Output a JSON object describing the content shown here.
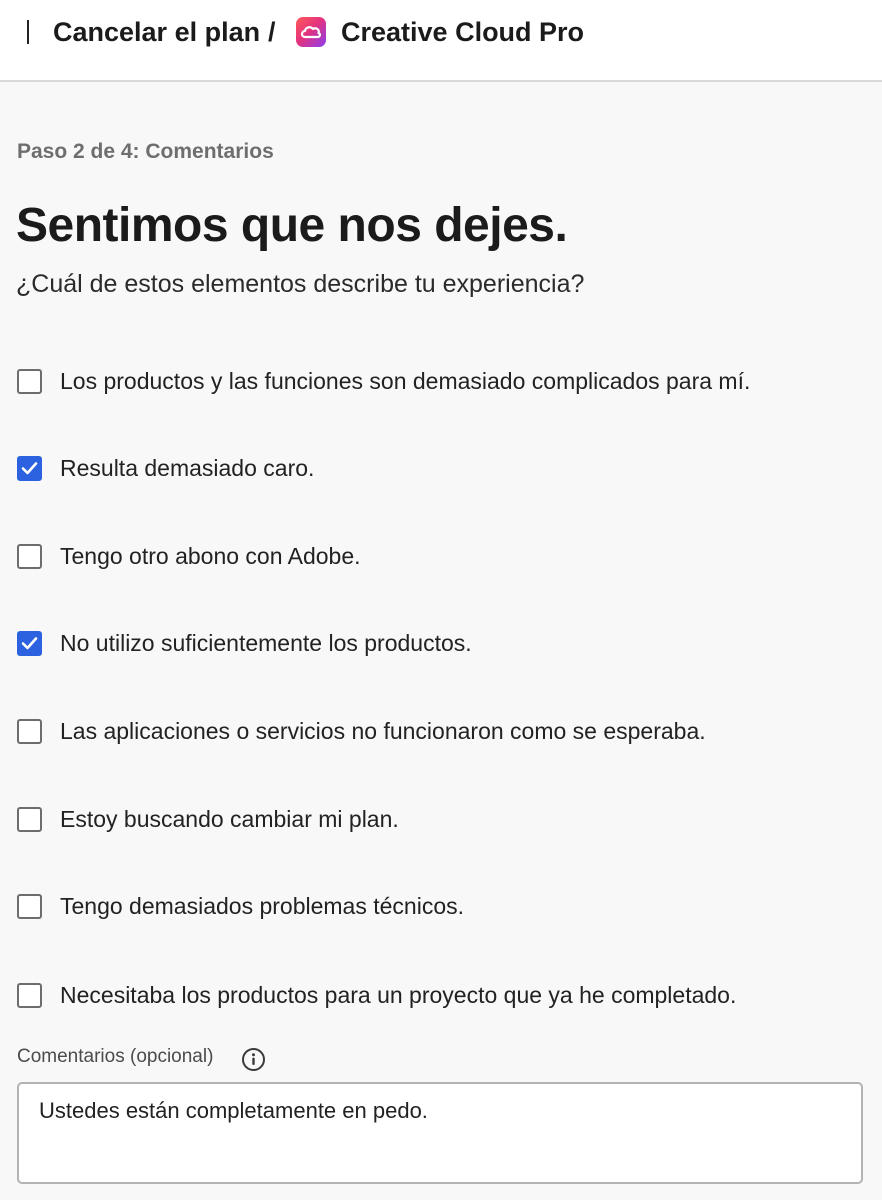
{
  "header": {
    "cancel_label": "Cancelar el plan",
    "separator": "/",
    "product_name": "Creative Cloud Pro"
  },
  "step_label": "Paso 2 de 4: Comentarios",
  "title": "Sentimos que nos dejes.",
  "subtitle": "¿Cuál de estos elementos describe tu experiencia?",
  "options": [
    {
      "label": "Los productos y las funciones son demasiado complicados para mí.",
      "checked": false
    },
    {
      "label": "Resulta demasiado caro.",
      "checked": true
    },
    {
      "label": "Tengo otro abono con Adobe.",
      "checked": false
    },
    {
      "label": "No utilizo suficientemente los productos.",
      "checked": true
    },
    {
      "label": "Las aplicaciones o servicios no funcionaron como se esperaba.",
      "checked": false
    },
    {
      "label": "Estoy buscando cambiar mi plan.",
      "checked": false
    },
    {
      "label": "Tengo demasiados problemas técnicos.",
      "checked": false
    },
    {
      "label": "Necesitaba los productos para un proyecto que ya he completado.",
      "checked": false
    }
  ],
  "comments": {
    "label": "Comentarios (opcional)",
    "value": "Ustedes están completamente en pedo."
  },
  "colors": {
    "accent": "#2c62e0",
    "background": "#f8f8f8"
  }
}
